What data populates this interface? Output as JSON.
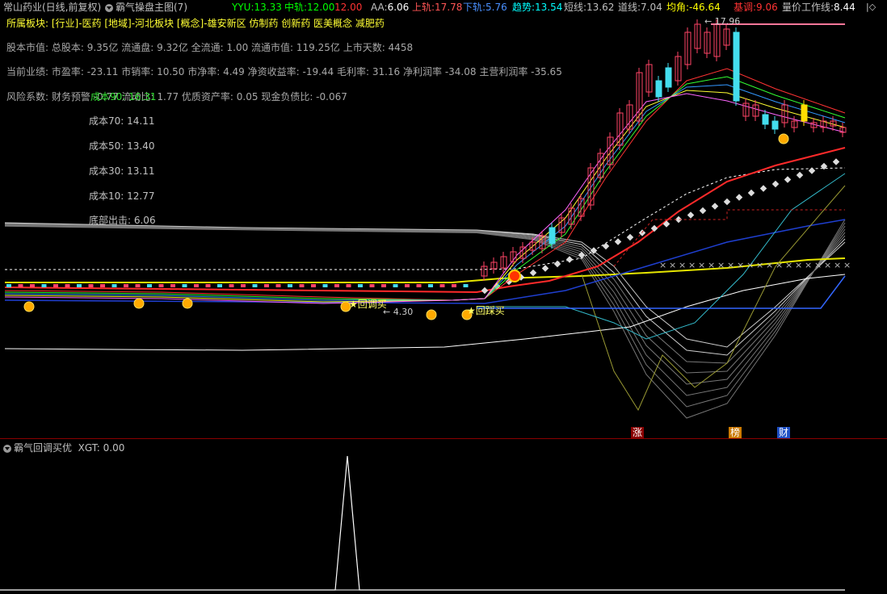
{
  "header": {
    "stock": "常山药业(日线,前复权)",
    "indicator_main": "霸气操盘主图(7)",
    "values": [
      {
        "label": "YYU:",
        "value": "13.33",
        "color": "#00ff00"
      },
      {
        "label": "中轨:",
        "value": "12.00",
        "color": "#00ff00"
      },
      {
        "label": "",
        "value": "12.00",
        "color": "#ff3333"
      },
      {
        "label": "AA:",
        "value": "6.06",
        "color": "#ffffff"
      },
      {
        "label": "上轨:",
        "value": "17.78",
        "color": "#ff5555"
      },
      {
        "label": "下轨:",
        "value": "5.76",
        "color": "#4a90ff"
      },
      {
        "label": "趋势:",
        "value": "13.54",
        "color": "#00ffff"
      },
      {
        "label": "短线:",
        "value": "13.62",
        "color": "#c0c0c0"
      },
      {
        "label": "道线:",
        "value": "7.04",
        "color": "#c0c0c0"
      },
      {
        "label": "均角:",
        "value": "-46.64",
        "color": "#ffff00"
      },
      {
        "label": "基调:",
        "value": "9.06",
        "color": "#ff3333"
      },
      {
        "label": "量价工作线:",
        "value": "8.44",
        "color": "#ffffff"
      }
    ]
  },
  "info": {
    "sector": "所属板块: [行业]-医药 [地域]-河北板块 [概念]-雄安新区 仿制药 创新药 医美概念 减肥药",
    "capital": "股本市值: 总股本: 9.35亿 流通盘: 9.32亿 全流通: 1.00 流通市值: 119.25亿 上市天数: 4458",
    "performance": "当前业绩: 市盈率: -23.11 市销率: 10.50 市净率: 4.49 净资收益率: -19.44 毛利率: 31.16 净利润率 -34.08 主营利润率 -35.65",
    "risk": "风险系数: 财务预警 -0.77 流动比: 1.77 优质资产率: 0.05 现金负债比: -0.067",
    "risk_overlay": "成本90: 16.31"
  },
  "costs": [
    {
      "label": "成本70: 14.11",
      "color": "#ffff66"
    },
    {
      "label": "成本50: 13.40",
      "color": "#33cccc"
    },
    {
      "label": "成本30: 13.11",
      "color": "#33dd33"
    },
    {
      "label": "成本10: 12.77",
      "color": "#ffff66"
    },
    {
      "label": "底部出击: 6.06",
      "color": "#ffffff"
    }
  ],
  "chart_labels": {
    "peak": "17.96",
    "low": "4.30",
    "buy1": "回调买",
    "buy2": "回踩买"
  },
  "tags": [
    {
      "text": "涨",
      "bg": "#8b0000"
    },
    {
      "text": "榜",
      "bg": "#cc7a00"
    },
    {
      "text": "财",
      "bg": "#1e4fc4"
    }
  ],
  "sub": {
    "title": "霸气回调买优",
    "value_label": "XGT:",
    "value": "0.00"
  },
  "chart_data": {
    "type": "line",
    "title": "霸气回调买优",
    "series": [
      {
        "name": "XGT",
        "values": [
          0,
          0,
          0,
          0,
          0,
          0,
          0,
          1,
          0,
          0,
          0,
          0,
          0,
          0,
          0,
          0,
          0,
          0,
          0,
          0,
          0,
          0,
          0,
          0,
          0
        ]
      }
    ]
  }
}
